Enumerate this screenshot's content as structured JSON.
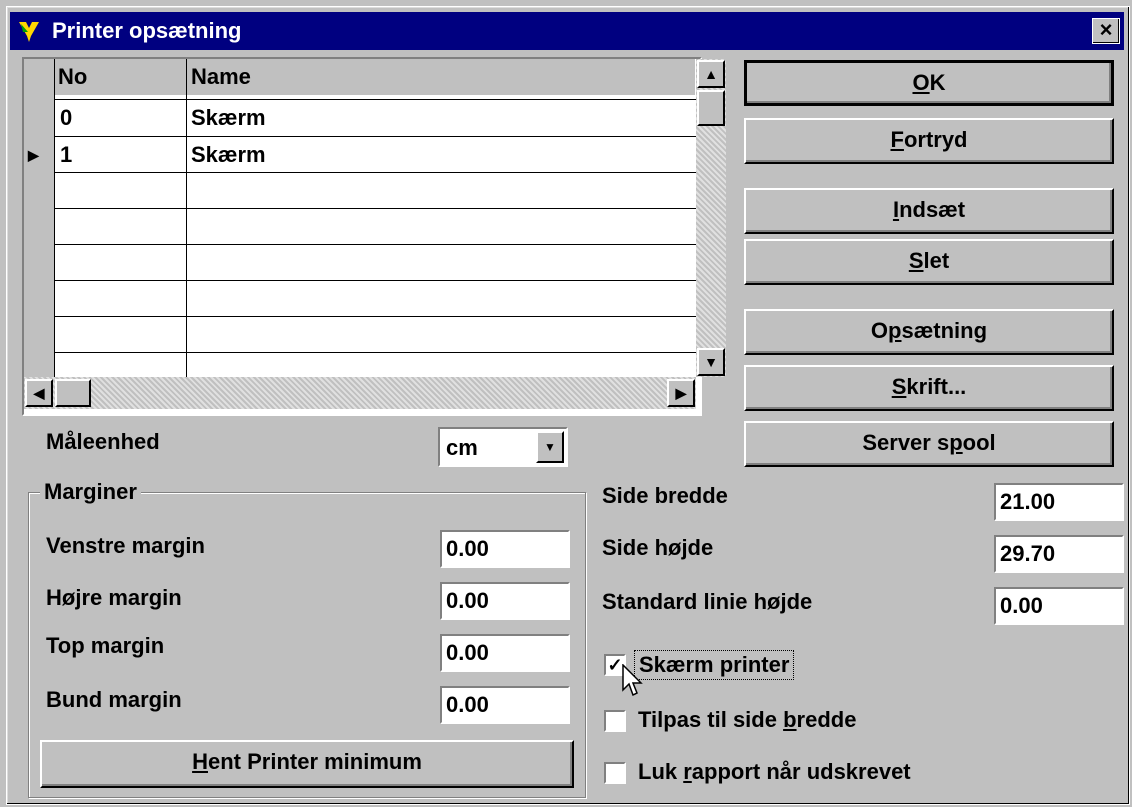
{
  "window": {
    "title": "Printer opsætning",
    "close_glyph": "×"
  },
  "grid": {
    "columns": [
      "No",
      "Name"
    ],
    "rows": [
      {
        "no": "0",
        "name": "Skærm"
      },
      {
        "no": "1",
        "name": "Skærm"
      }
    ],
    "current_row_marker": "▶"
  },
  "buttons": {
    "ok": {
      "key": "O",
      "rest": "K"
    },
    "fortryd": {
      "key": "F",
      "rest": "ortryd"
    },
    "indsaet": {
      "key": "I",
      "rest": "ndsæt"
    },
    "slet": {
      "key": "S",
      "rest": "let"
    },
    "opsaetning": {
      "pre": "O",
      "key": "p",
      "rest": "sætning"
    },
    "skrift": {
      "key": "S",
      "rest": "krift..."
    },
    "server_spool": {
      "pre": "Server s",
      "key": "p",
      "rest": "ool"
    },
    "hent": {
      "key": "H",
      "rest": "ent Printer minimum"
    }
  },
  "units": {
    "label": "Måleenhed",
    "value": "cm"
  },
  "margins": {
    "group_label": "Marginer",
    "venstre": {
      "label": "Venstre margin",
      "value": "0.00"
    },
    "hojre": {
      "label": "Højre margin",
      "value": "0.00"
    },
    "top": {
      "label": "Top margin",
      "value": "0.00"
    },
    "bund": {
      "label": "Bund margin",
      "value": "0.00"
    }
  },
  "page": {
    "bredde": {
      "label": "Side bredde",
      "value": "21.00"
    },
    "hojde": {
      "label": "Side højde",
      "value": "29.70"
    },
    "linie": {
      "label": "Standard linie højde",
      "value": "0.00"
    }
  },
  "options": {
    "skaerm_printer": {
      "label": "Skærm printer",
      "checked": true,
      "check_glyph": "✓"
    },
    "tilpas": {
      "pre": "Tilpas til side ",
      "key": "b",
      "rest": "redde",
      "checked": false
    },
    "luk": {
      "pre": "Luk ",
      "key": "r",
      "rest": "apport når udskrevet",
      "checked": false
    }
  },
  "scroll": {
    "up": "▲",
    "down": "▼",
    "left": "◀",
    "right": "▶"
  }
}
